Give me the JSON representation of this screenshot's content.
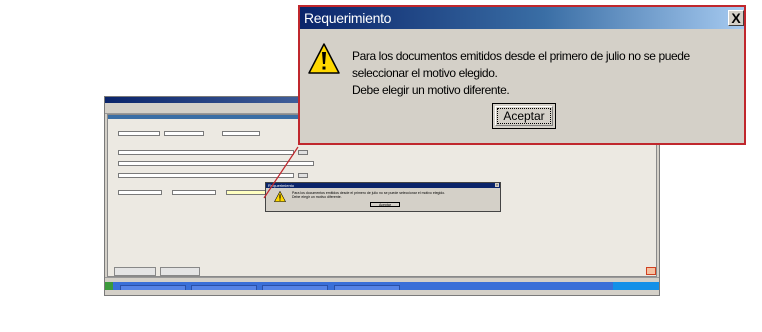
{
  "dialog": {
    "title": "Requerimiento",
    "close_glyph": "X",
    "message_line1": "Para los documentos emitidos desde el primero de julio no se puede seleccionar el motivo elegido.",
    "message_line2": "Debe elegir un motivo diferente.",
    "ok_label": "Aceptar",
    "icon": "warning-icon",
    "accent_color": "#c0272d"
  },
  "small_dialog": {
    "title": "Requerimiento",
    "message_line1": "Para los documentos emitidos desde el primero de julio no se puede seleccionar el motivo elegido.",
    "message_line2": "Debe elegir un motivo diferente.",
    "ok_label": "Aceptar"
  }
}
